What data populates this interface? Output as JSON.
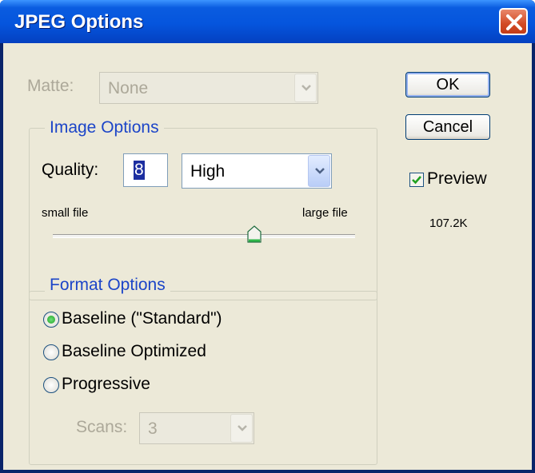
{
  "window": {
    "title": "JPEG Options"
  },
  "matte": {
    "label": "Matte:",
    "value": "None"
  },
  "image_options": {
    "legend": "Image Options",
    "quality_label": "Quality:",
    "quality_value": "8",
    "quality_preset": "High",
    "slider_min_label": "small file",
    "slider_max_label": "large file",
    "slider_level": "8"
  },
  "format_options": {
    "legend": "Format Options",
    "options": [
      {
        "label": "Baseline (\"Standard\")",
        "selected": true
      },
      {
        "label": "Baseline Optimized",
        "selected": false
      },
      {
        "label": "Progressive",
        "selected": false
      }
    ],
    "scans_label": "Scans:",
    "scans_value": "3"
  },
  "buttons": {
    "ok": "OK",
    "cancel": "Cancel"
  },
  "preview": {
    "label": "Preview",
    "checked": true,
    "file_size": "107.2K"
  },
  "colors": {
    "title_bar": "#0555dd",
    "close": "#d24a25",
    "dialog_bg": "#ece9d8",
    "group_legend": "#1c45c8"
  }
}
